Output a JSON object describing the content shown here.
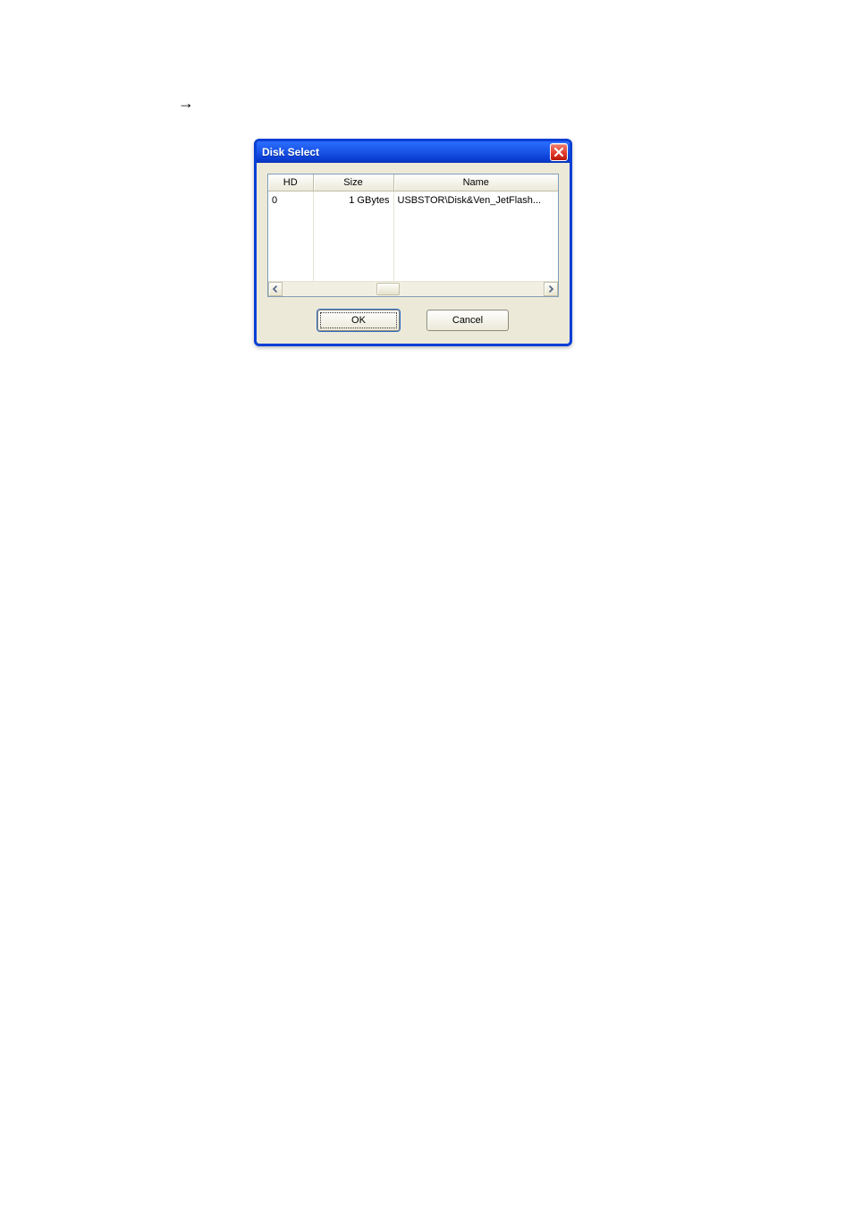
{
  "page_arrow_glyph": "→",
  "dialog": {
    "title": "Disk Select",
    "columns": {
      "hd": "HD",
      "size": "Size",
      "name": "Name"
    },
    "rows": [
      {
        "hd": "0",
        "size": "1 GBytes",
        "name": "USBSTOR\\Disk&Ven_JetFlash..."
      }
    ],
    "buttons": {
      "ok": "OK",
      "cancel": "Cancel"
    }
  }
}
